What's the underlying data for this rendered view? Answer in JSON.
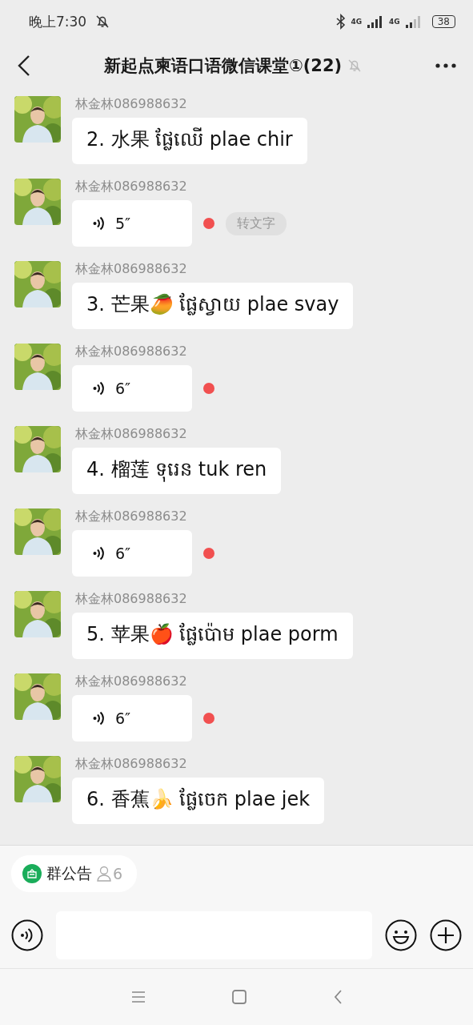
{
  "status_bar": {
    "time": "晚上7:30",
    "battery": "38",
    "network_1": "4G",
    "network_2": "4G"
  },
  "header": {
    "title": "新起点柬语口语微信课堂①(22)",
    "muted": true
  },
  "messages": [
    {
      "kind": "text",
      "sender": "林金林086988632",
      "text": "2. 水果 ផ្លែឈើ plae chir"
    },
    {
      "kind": "voice",
      "sender": "林金林086988632",
      "duration": "5″",
      "unread": true,
      "convert_label": "转文字"
    },
    {
      "kind": "text",
      "sender": "林金林086988632",
      "text": "3. 芒果🥭 ផ្លែស្វាយ plae svay"
    },
    {
      "kind": "voice",
      "sender": "林金林086988632",
      "duration": "6″",
      "unread": true
    },
    {
      "kind": "text",
      "sender": "林金林086988632",
      "text": "4. 榴莲 ទុរេន tuk ren"
    },
    {
      "kind": "voice",
      "sender": "林金林086988632",
      "duration": "6″",
      "unread": true
    },
    {
      "kind": "text",
      "sender": "林金林086988632",
      "text": "5. 苹果🍎 ផ្លែប៉ោម plae porm"
    },
    {
      "kind": "voice",
      "sender": "林金林086988632",
      "duration": "6″",
      "unread": true
    },
    {
      "kind": "text",
      "sender": "林金林086988632",
      "text": "6. 香蕉🍌 ផ្លែចេក plae jek"
    }
  ],
  "announcement": {
    "label": "群公告",
    "count": "6"
  }
}
